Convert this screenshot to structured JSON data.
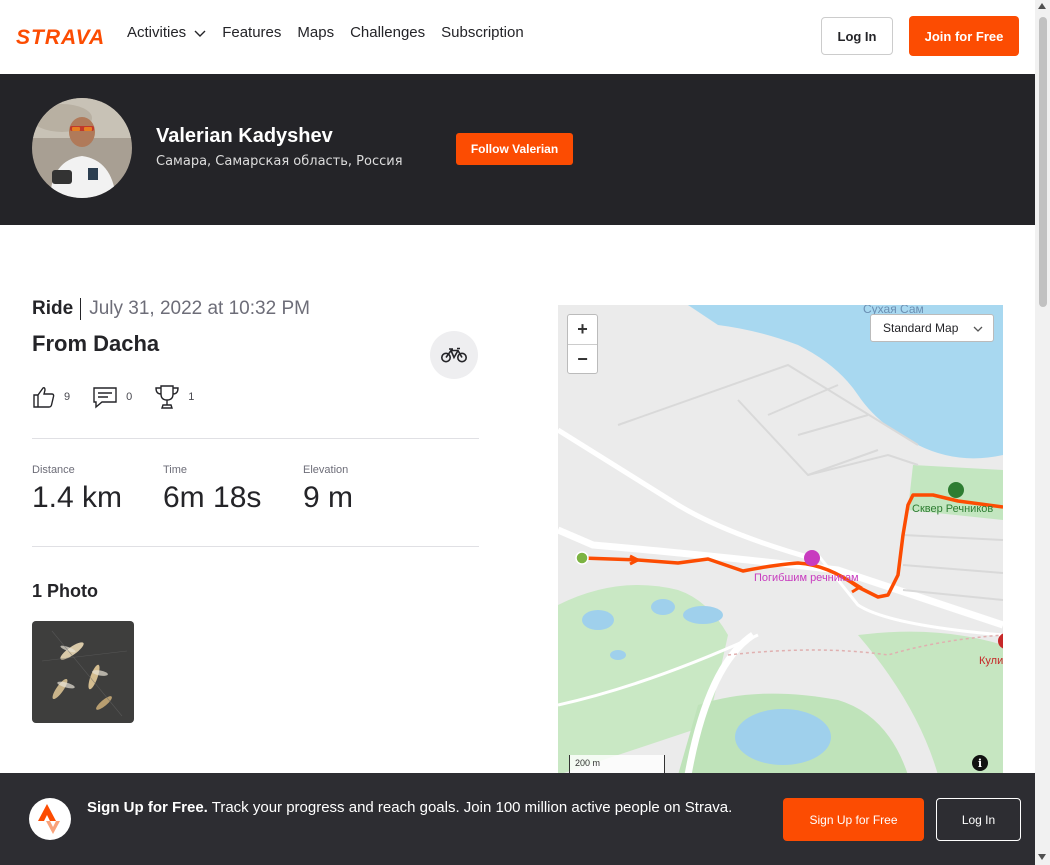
{
  "nav": {
    "brand": "STRAVA",
    "links": [
      "Activities",
      "Features",
      "Maps",
      "Challenges",
      "Subscription"
    ],
    "login": "Log In",
    "join": "Join for Free"
  },
  "athlete": {
    "name": "Valerian Kadyshev",
    "location": "Самара, Самарская область, Россия",
    "follow": "Follow Valerian"
  },
  "activity": {
    "type": "Ride",
    "date": "July 31, 2022 at 10:32 PM",
    "title": "From Dacha",
    "kudos": "9",
    "comments": "0",
    "achievements": "1",
    "stats": [
      {
        "label": "Distance",
        "value": "1.4 km"
      },
      {
        "label": "Time",
        "value": "6m 18s"
      },
      {
        "label": "Elevation",
        "value": "9 m"
      }
    ],
    "photos_title": "1 Photo"
  },
  "map": {
    "zoom_in": "+",
    "zoom_out": "−",
    "type": "Standard Map",
    "scale": "200 m",
    "info": "i",
    "labels": {
      "sukhaya": "Сухая Сам",
      "square": "Сквер Речников",
      "memorial": "Погибшим речникам",
      "kul": "Кули"
    }
  },
  "banner": {
    "bold": "Sign Up for Free.",
    "text": " Track your progress and reach goals. Join 100 million active people on Strava.",
    "signup": "Sign Up for Free",
    "login": "Log In"
  },
  "colors": {
    "brand": "#fc4c02",
    "header_bg": "#242428",
    "banner_bg": "#2d2d32"
  }
}
